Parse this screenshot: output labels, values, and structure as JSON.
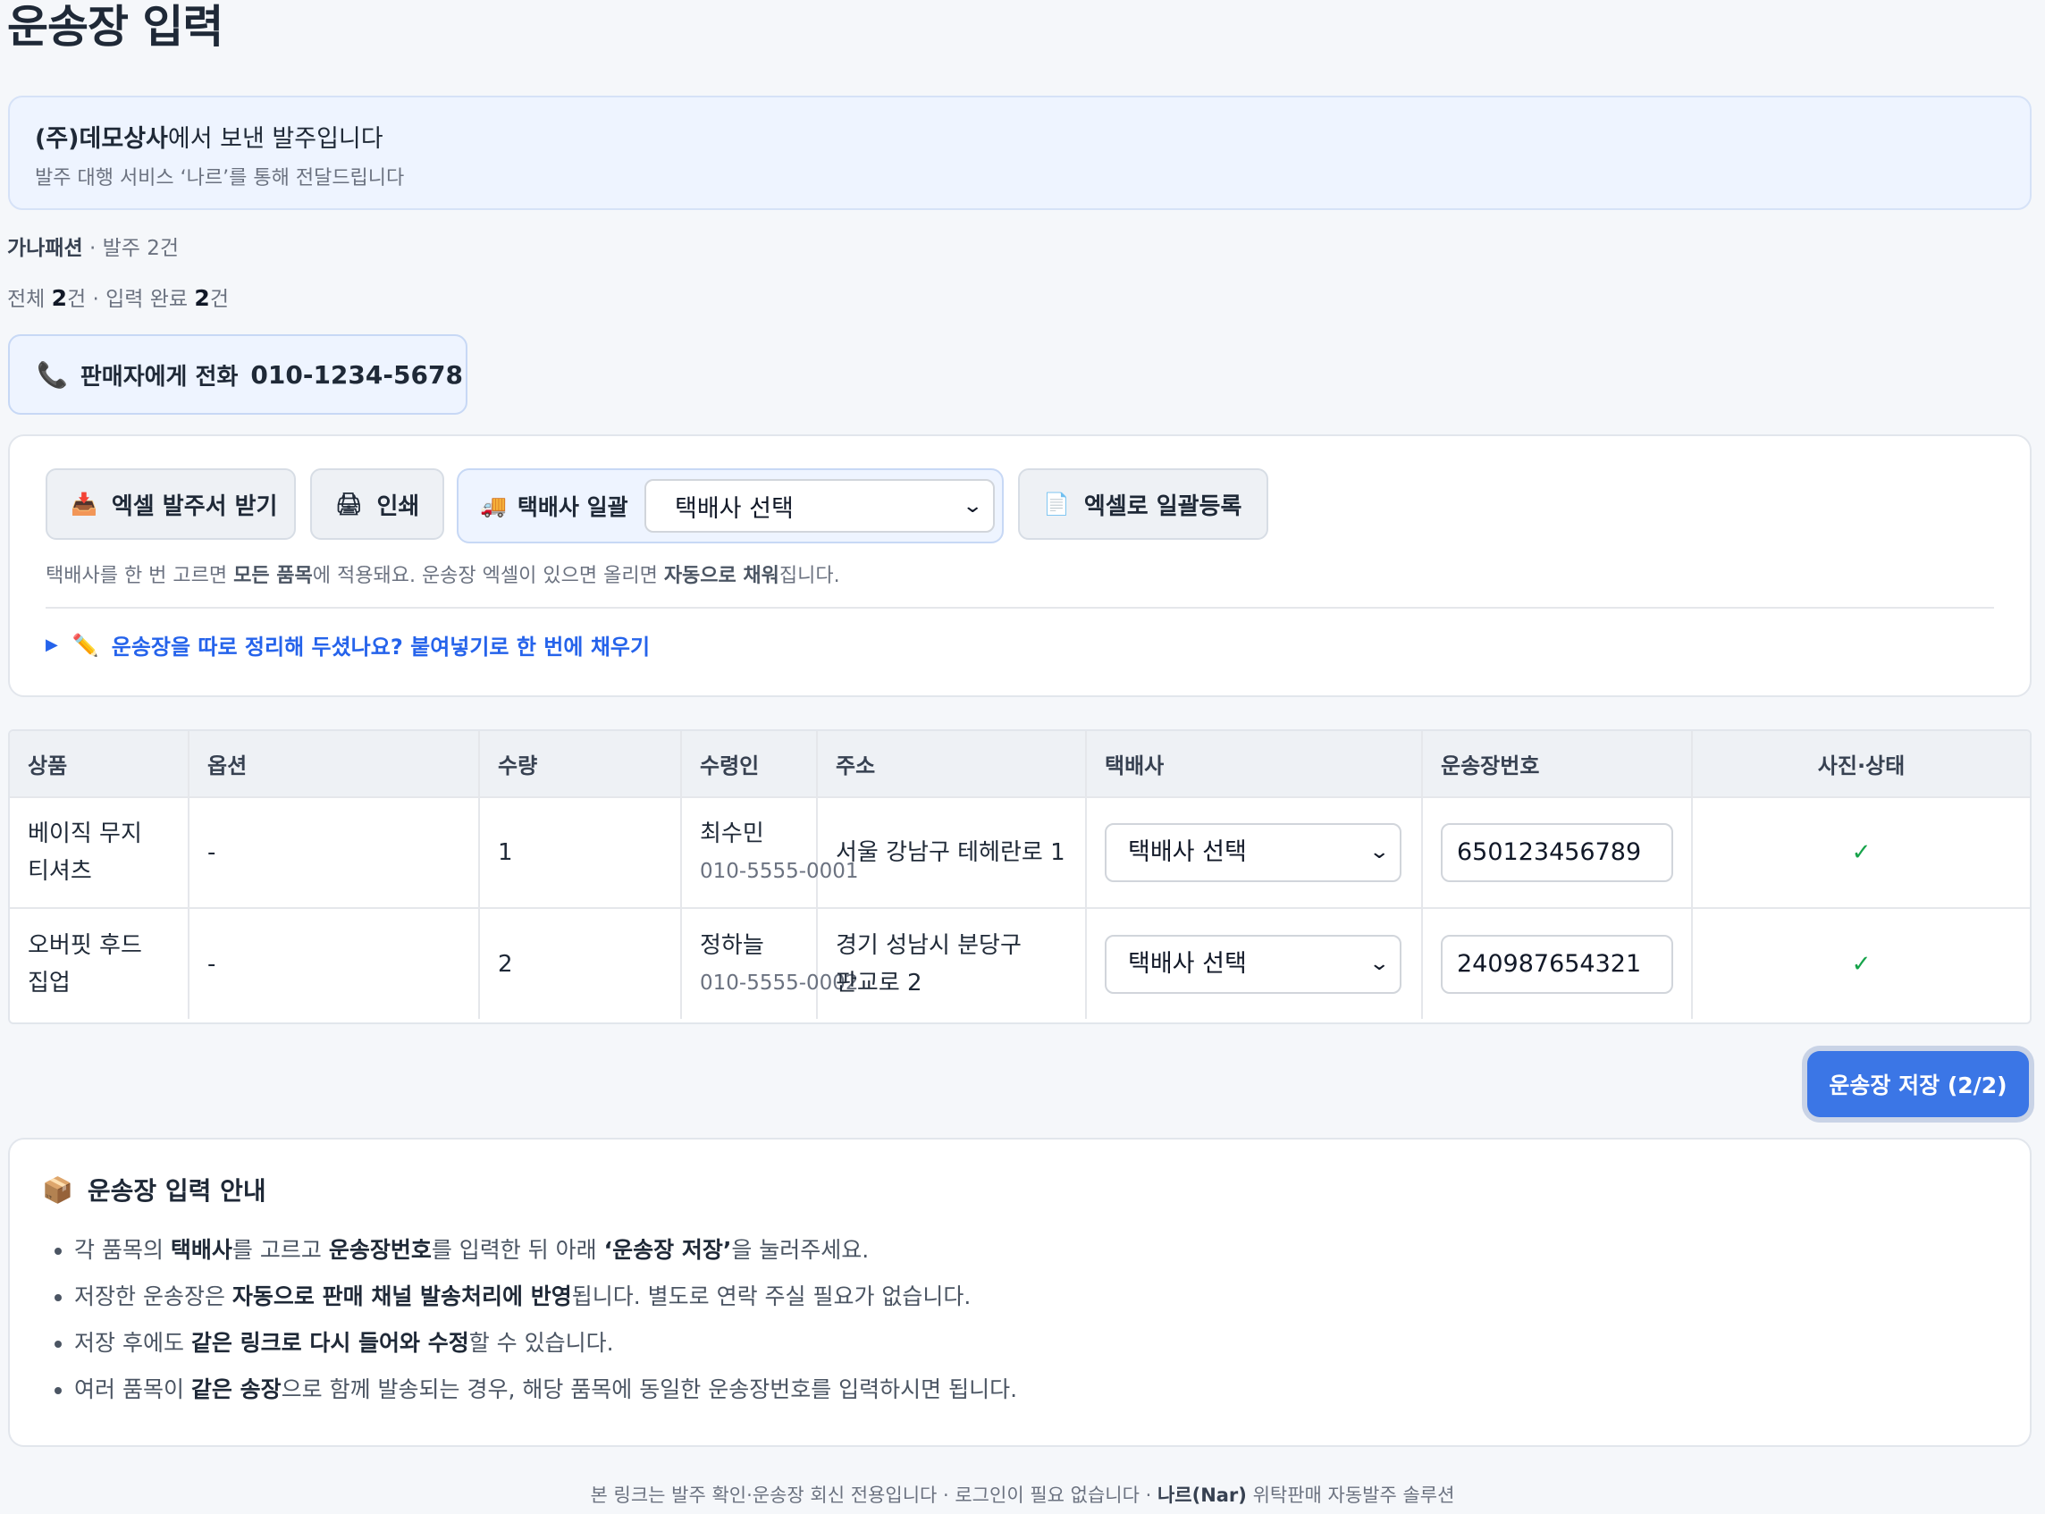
{
  "page": {
    "title": "운송장 입력"
  },
  "notice": {
    "sender": "(주)데모상사",
    "sender_suffix": "에서 보낸 발주입니다",
    "sub": "발주 대행 서비스 ‘나르’를 통해 전달드립니다"
  },
  "meta": {
    "shop": "가나패션",
    "orders": " · 발주 2건",
    "total_label": "전체 ",
    "total_count": "2",
    "total_unit": "건 · 입력 완료 ",
    "done_count": "2",
    "done_unit": "건"
  },
  "call": {
    "icon": "phone-icon",
    "label": "판매자에게 전화",
    "number": "010-1234-5678"
  },
  "toolbar": {
    "excel_download": "엑셀 발주서 받기",
    "print": "인쇄",
    "bulk_label": "택배사 일괄",
    "bulk_select": "택배사 선택",
    "excel_upload": "엑셀로 일괄등록",
    "hint_1": "택배사를 한 번 고르면 ",
    "hint_b1": "모든 품목",
    "hint_2": "에 적용돼요. 운송장 엑셀이 있으면 올리면 ",
    "hint_b2": "자동으로 채워",
    "hint_3": "집니다.",
    "paste_link": "운송장을 따로 정리해 두셨나요? 붙여넣기로 한 번에 채우기"
  },
  "table": {
    "headers": [
      "상품",
      "옵션",
      "수량",
      "수령인",
      "주소",
      "택배사",
      "운송장번호",
      "사진·상태"
    ],
    "rows": [
      {
        "product": "베이직 무지 티셔츠",
        "option": "-",
        "qty": "1",
        "receiver": "최수민",
        "phone": "010-5555-0001",
        "address": "서울 강남구 테헤란로 1",
        "carrier": "택배사 선택",
        "waybill": "650123456789",
        "status": "✓"
      },
      {
        "product": "오버핏 후드 집업",
        "option": "-",
        "qty": "2",
        "receiver": "정하늘",
        "phone": "010-5555-0002",
        "address": "경기 성남시 분당구 판교로 2",
        "carrier": "택배사 선택",
        "waybill": "240987654321",
        "status": "✓"
      }
    ]
  },
  "save": {
    "label": "운송장 저장 (2/2)"
  },
  "guide": {
    "title": "운송장 입력 안내",
    "items": [
      {
        "a": "각 품목의 ",
        "b1": "택배사",
        "c": "를 고르고 ",
        "b2": "운송장번호",
        "d": "를 입력한 뒤 아래 ",
        "b3": "‘운송장 저장’",
        "e": "을 눌러주세요."
      },
      {
        "a": "저장한 운송장은 ",
        "b1": "자동으로 판매 채널 발송처리에 반영",
        "c": "됩니다. 별도로 연락 주실 필요가 없습니다."
      },
      {
        "a": "저장 후에도 ",
        "b1": "같은 링크로 다시 들어와 수정",
        "c": "할 수 있습니다."
      },
      {
        "a": "여러 품목이 ",
        "b1": "같은 송장",
        "c": "으로 함께 발송되는 경우, 해당 품목에 동일한 운송장번호를 입력하시면 됩니다."
      }
    ]
  },
  "footer": {
    "text": "본 링크는 발주 확인·운송장 회신 전용입니다 · 로그인이 필요 없습니다 · ",
    "brand": "나르(Nar)",
    "tail": " 위탁판매 자동발주 솔루션"
  },
  "colors": {
    "accent": "#3b76e6",
    "link": "#2563eb",
    "success": "#16a34a"
  }
}
